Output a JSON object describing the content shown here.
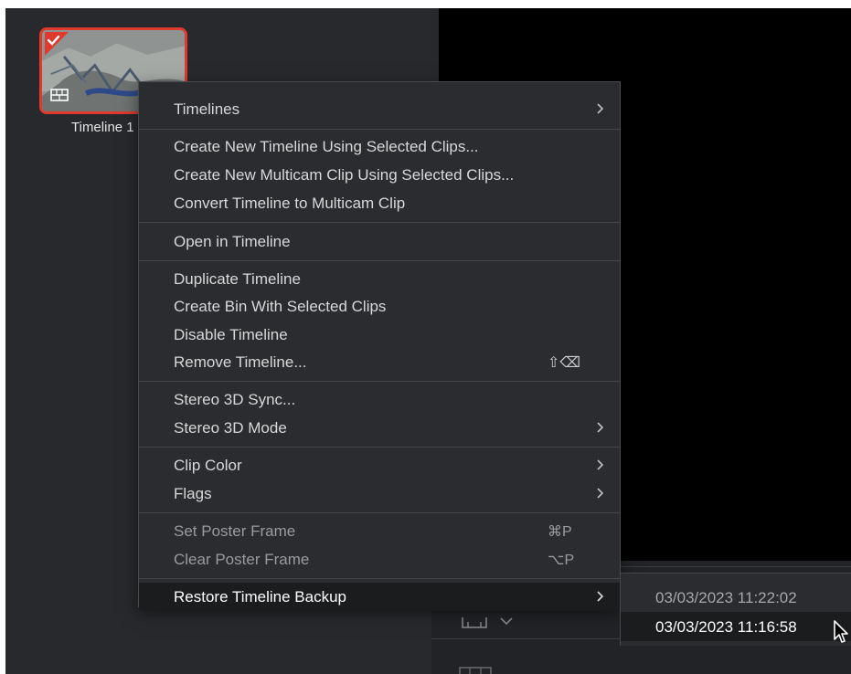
{
  "media_pool": {
    "clip": {
      "name": "Timeline 1",
      "selected": true
    }
  },
  "context_menu": {
    "items": [
      {
        "label": "Timelines",
        "submenu": true
      },
      {
        "label": "Create New Timeline Using Selected Clips..."
      },
      {
        "label": "Create New Multicam Clip Using Selected Clips..."
      },
      {
        "label": "Convert Timeline to Multicam Clip"
      },
      {
        "label": "Open in Timeline"
      },
      {
        "label": "Duplicate Timeline"
      },
      {
        "label": "Create Bin With Selected Clips"
      },
      {
        "label": "Disable Timeline"
      },
      {
        "label": "Remove Timeline...",
        "shortcut": "⇧⌫"
      },
      {
        "label": "Stereo 3D Sync..."
      },
      {
        "label": "Stereo 3D Mode",
        "submenu": true
      },
      {
        "label": "Clip Color",
        "submenu": true
      },
      {
        "label": "Flags",
        "submenu": true
      },
      {
        "label": "Set Poster Frame",
        "shortcut": "⌘P",
        "disabled": true
      },
      {
        "label": "Clear Poster Frame",
        "shortcut": "⌥P",
        "disabled": true
      },
      {
        "label": "Restore Timeline Backup",
        "submenu": true,
        "highlighted": true
      }
    ]
  },
  "backup_submenu": {
    "items": [
      {
        "label": "03/03/2023 11:22:02"
      },
      {
        "label": "03/03/2023 11:16:58",
        "hovered": true
      }
    ]
  },
  "colors": {
    "selection_border": "#e03a2f",
    "menu_background": "#2b2c2f",
    "highlight_background": "#1b1c1e"
  }
}
